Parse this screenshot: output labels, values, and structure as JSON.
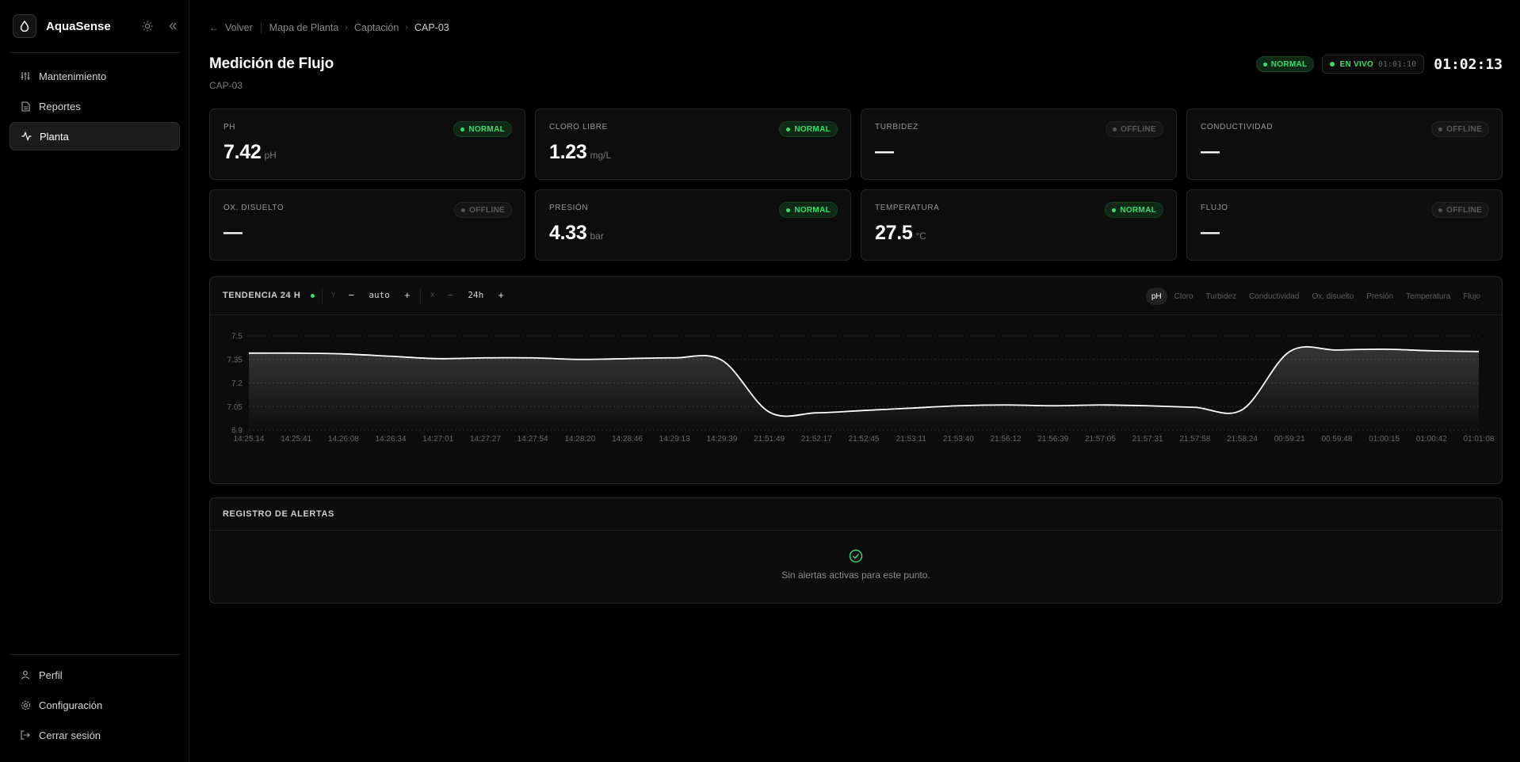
{
  "app": {
    "name": "AquaSense"
  },
  "sidebar": {
    "items": [
      {
        "label": "Mantenimiento",
        "icon": "sliders-icon"
      },
      {
        "label": "Reportes",
        "icon": "document-icon"
      },
      {
        "label": "Planta",
        "icon": "activity-icon",
        "active": true
      }
    ],
    "footer": [
      {
        "label": "Perfil",
        "icon": "user-icon"
      },
      {
        "label": "Configuración",
        "icon": "gear-icon"
      },
      {
        "label": "Cerrar sesión",
        "icon": "logout-icon"
      }
    ]
  },
  "breadcrumb": {
    "back": "Volver",
    "items": [
      "Mapa de Planta",
      "Captación",
      "CAP-03"
    ]
  },
  "header": {
    "title": "Medición de Flujo",
    "subtitle": "CAP-03",
    "status": "NORMAL",
    "live_label": "EN VIVO",
    "live_time": "01:01:10",
    "clock": "01:02:13"
  },
  "metrics": [
    {
      "label": "PH",
      "value": "7.42",
      "unit": "pH",
      "status": "NORMAL"
    },
    {
      "label": "CLORO LIBRE",
      "value": "1.23",
      "unit": "mg/L",
      "status": "NORMAL"
    },
    {
      "label": "TURBIDEZ",
      "value": "—",
      "unit": "",
      "status": "OFFLINE"
    },
    {
      "label": "CONDUCTIVIDAD",
      "value": "—",
      "unit": "",
      "status": "OFFLINE"
    },
    {
      "label": "OX. DISUELTO",
      "value": "—",
      "unit": "",
      "status": "OFFLINE"
    },
    {
      "label": "PRESIÓN",
      "value": "4.33",
      "unit": "bar",
      "status": "NORMAL"
    },
    {
      "label": "TEMPERATURA",
      "value": "27.5",
      "unit": "°C",
      "status": "NORMAL"
    },
    {
      "label": "FLUJO",
      "value": "—",
      "unit": "",
      "status": "OFFLINE"
    }
  ],
  "chart_panel": {
    "title": "TENDENCIA 24 H",
    "y_label": "Y",
    "y_value": "auto",
    "x_label": "X",
    "x_value": "24h",
    "minus": "−",
    "plus": "+",
    "tabs": [
      "pH",
      "Cloro",
      "Turbidez",
      "Conductividad",
      "Ox. disuelto",
      "Presión",
      "Temperatura",
      "Flujo"
    ],
    "active_tab": "pH"
  },
  "chart_data": {
    "type": "area",
    "yticks": [
      "7.5",
      "7.35",
      "7.2",
      "7.05",
      "6.9"
    ],
    "ylim": [
      6.9,
      7.5
    ],
    "x": [
      "14:25:14",
      "14:25:41",
      "14:26:08",
      "14:26:34",
      "14:27:01",
      "14:27:27",
      "14:27:54",
      "14:28:20",
      "14:28:46",
      "14:29:13",
      "14:29:39",
      "21:51:49",
      "21:52:17",
      "21:52:45",
      "21:53:11",
      "21:53:40",
      "21:56:12",
      "21:56:39",
      "21:57:05",
      "21:57:31",
      "21:57:58",
      "21:58:24",
      "00:59:21",
      "00:59:48",
      "01:00:15",
      "01:00:42",
      "01:01:08"
    ],
    "series": [
      {
        "values": [
          7.39,
          7.39,
          7.385,
          7.37,
          7.355,
          7.36,
          7.36,
          7.35,
          7.355,
          7.36,
          7.345,
          7.015,
          7.01,
          7.025,
          7.04,
          7.055,
          7.06,
          7.055,
          7.06,
          7.055,
          7.045,
          7.03,
          7.4,
          7.41,
          7.415,
          7.405,
          7.4
        ]
      }
    ]
  },
  "alerts": {
    "title": "REGISTRO DE ALERTAS",
    "empty_message": "Sin alertas activas para este punto."
  },
  "colors": {
    "normal": "#3ddc6a",
    "line": "#ffffff"
  }
}
